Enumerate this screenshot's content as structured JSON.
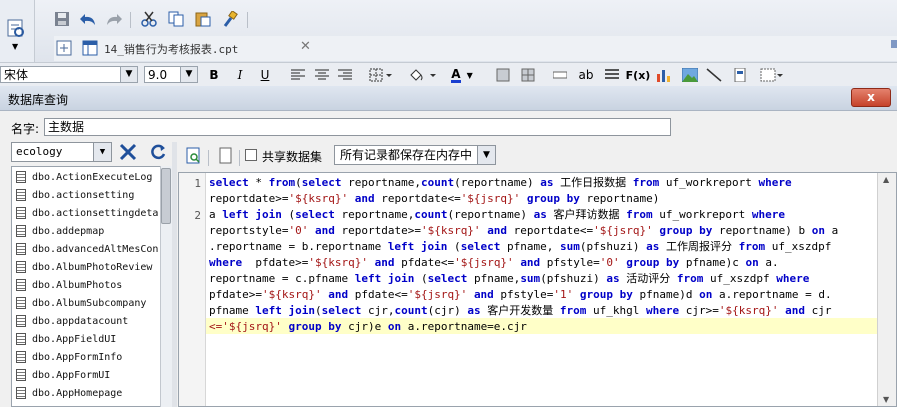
{
  "tab": {
    "file_name": "14_销售行为考核报表.cpt"
  },
  "format_bar": {
    "font_name": "宋体",
    "font_size": "9.0",
    "bold": "B",
    "italic": "I",
    "underline": "U",
    "text_ab": "ab",
    "formula": "F(x)",
    "font_color_letter": "A"
  },
  "dialog": {
    "title": "数据库查询",
    "close": "x",
    "name_label": "名字:",
    "name_value": "主数据",
    "db_selected": "ecology",
    "shared_label": "共享数据集",
    "save_mode": "所有记录都保存在内存中"
  },
  "tables": [
    "dbo.ActionExecuteLog",
    "dbo.actionsetting",
    "dbo.actionsettingdeta",
    "dbo.addepmap",
    "dbo.advancedAltMesCon",
    "dbo.AlbumPhotoReview",
    "dbo.AlbumPhotos",
    "dbo.AlbumSubcompany",
    "dbo.appdatacount",
    "dbo.AppFieldUI",
    "dbo.AppFormInfo",
    "dbo.AppFormUI",
    "dbo.AppHomepage"
  ],
  "editor": {
    "line_numbers": [
      "1",
      "2"
    ],
    "lines": [
      [
        {
          "t": "select",
          "k": 1
        },
        {
          "t": " * "
        },
        {
          "t": "from",
          "k": 1
        },
        {
          "t": "("
        },
        {
          "t": "select",
          "k": 1
        },
        {
          "t": " reportname,"
        },
        {
          "t": "count",
          "k": 1
        },
        {
          "t": "(reportname) "
        },
        {
          "t": "as",
          "k": 1
        },
        {
          "t": " 工作日报数据 "
        },
        {
          "t": "from",
          "k": 1
        },
        {
          "t": " uf_workreport "
        },
        {
          "t": "where",
          "k": 1
        }
      ],
      [
        {
          "t": "reportdate>="
        },
        {
          "t": "'${ksrq}'",
          "s": 1
        },
        {
          "t": " "
        },
        {
          "t": "and",
          "k": 1
        },
        {
          "t": " reportdate<="
        },
        {
          "t": "'${jsrq}'",
          "s": 1
        },
        {
          "t": " "
        },
        {
          "t": "group",
          "k": 1
        },
        {
          "t": " "
        },
        {
          "t": "by",
          "k": 1
        },
        {
          "t": " reportname)"
        }
      ],
      [
        {
          "t": "a "
        },
        {
          "t": "left",
          "k": 1
        },
        {
          "t": " "
        },
        {
          "t": "join",
          "k": 1
        },
        {
          "t": " ("
        },
        {
          "t": "select",
          "k": 1
        },
        {
          "t": " reportname,"
        },
        {
          "t": "count",
          "k": 1
        },
        {
          "t": "(reportname) "
        },
        {
          "t": "as",
          "k": 1
        },
        {
          "t": " 客户拜访数据 "
        },
        {
          "t": "from",
          "k": 1
        },
        {
          "t": " uf_workreport "
        },
        {
          "t": "where",
          "k": 1
        }
      ],
      [
        {
          "t": "reportstyle="
        },
        {
          "t": "'0'",
          "s": 1
        },
        {
          "t": " "
        },
        {
          "t": "and",
          "k": 1
        },
        {
          "t": " reportdate>="
        },
        {
          "t": "'${ksrq}'",
          "s": 1
        },
        {
          "t": " "
        },
        {
          "t": "and",
          "k": 1
        },
        {
          "t": " reportdate<="
        },
        {
          "t": "'${jsrq}'",
          "s": 1
        },
        {
          "t": " "
        },
        {
          "t": "group",
          "k": 1
        },
        {
          "t": " "
        },
        {
          "t": "by",
          "k": 1
        },
        {
          "t": " reportname) b "
        },
        {
          "t": "on",
          "k": 1
        },
        {
          "t": " a"
        }
      ],
      [
        {
          "t": ".reportname = b.reportname "
        },
        {
          "t": "left",
          "k": 1
        },
        {
          "t": " "
        },
        {
          "t": "join",
          "k": 1
        },
        {
          "t": " ("
        },
        {
          "t": "select",
          "k": 1
        },
        {
          "t": " pfname, "
        },
        {
          "t": "sum",
          "k": 1
        },
        {
          "t": "(pfshuzi) "
        },
        {
          "t": "as",
          "k": 1
        },
        {
          "t": " 工作周报评分 "
        },
        {
          "t": "from",
          "k": 1
        },
        {
          "t": " uf_xszdpf"
        }
      ],
      [
        {
          "t": "where",
          "k": 1
        },
        {
          "t": "  pfdate>="
        },
        {
          "t": "'${ksrq}'",
          "s": 1
        },
        {
          "t": " "
        },
        {
          "t": "and",
          "k": 1
        },
        {
          "t": " pfdate<="
        },
        {
          "t": "'${jsrq}'",
          "s": 1
        },
        {
          "t": " "
        },
        {
          "t": "and",
          "k": 1
        },
        {
          "t": " pfstyle="
        },
        {
          "t": "'0'",
          "s": 1
        },
        {
          "t": " "
        },
        {
          "t": "group",
          "k": 1
        },
        {
          "t": " "
        },
        {
          "t": "by",
          "k": 1
        },
        {
          "t": " pfname)c "
        },
        {
          "t": "on",
          "k": 1
        },
        {
          "t": " a."
        }
      ],
      [
        {
          "t": "reportname = c.pfname "
        },
        {
          "t": "left",
          "k": 1
        },
        {
          "t": " "
        },
        {
          "t": "join",
          "k": 1
        },
        {
          "t": " ("
        },
        {
          "t": "select",
          "k": 1
        },
        {
          "t": " pfname,"
        },
        {
          "t": "sum",
          "k": 1
        },
        {
          "t": "(pfshuzi) "
        },
        {
          "t": "as",
          "k": 1
        },
        {
          "t": " 活动评分 "
        },
        {
          "t": "from",
          "k": 1
        },
        {
          "t": " uf_xszdpf "
        },
        {
          "t": "where",
          "k": 1
        }
      ],
      [
        {
          "t": "pfdate>="
        },
        {
          "t": "'${ksrq}'",
          "s": 1
        },
        {
          "t": " "
        },
        {
          "t": "and",
          "k": 1
        },
        {
          "t": " pfdate<="
        },
        {
          "t": "'${jsrq}'",
          "s": 1
        },
        {
          "t": " "
        },
        {
          "t": "and",
          "k": 1
        },
        {
          "t": " pfstyle="
        },
        {
          "t": "'1'",
          "s": 1
        },
        {
          "t": " "
        },
        {
          "t": "group",
          "k": 1
        },
        {
          "t": " "
        },
        {
          "t": "by",
          "k": 1
        },
        {
          "t": " pfname)d "
        },
        {
          "t": "on",
          "k": 1
        },
        {
          "t": " a.reportname = d."
        }
      ],
      [
        {
          "t": "pfname "
        },
        {
          "t": "left",
          "k": 1
        },
        {
          "t": " "
        },
        {
          "t": "join",
          "k": 1
        },
        {
          "t": "("
        },
        {
          "t": "select",
          "k": 1
        },
        {
          "t": " cjr,"
        },
        {
          "t": "count",
          "k": 1
        },
        {
          "t": "(cjr) "
        },
        {
          "t": "as",
          "k": 1
        },
        {
          "t": " 客户开发数量 "
        },
        {
          "t": "from",
          "k": 1
        },
        {
          "t": " uf_khgl "
        },
        {
          "t": "where",
          "k": 1
        },
        {
          "t": " cjr>="
        },
        {
          "t": "'${ksrq}'",
          "s": 1
        },
        {
          "t": " "
        },
        {
          "t": "and",
          "k": 1
        },
        {
          "t": " cjr"
        }
      ],
      [
        {
          "t": "<=",
          "s": 1
        },
        {
          "t": "'${jsrq}'",
          "s": 1
        },
        {
          "t": " "
        },
        {
          "t": "group",
          "k": 1
        },
        {
          "t": " "
        },
        {
          "t": "by",
          "k": 1
        },
        {
          "t": " cjr)e "
        },
        {
          "t": "on",
          "k": 1
        },
        {
          "t": " a.reportname=e.cjr"
        }
      ]
    ]
  },
  "icons": {
    "save": "save-icon",
    "undo": "undo-icon",
    "redo": "redo-icon",
    "cut": "cut-icon",
    "copy": "copy-icon",
    "paste": "paste-icon",
    "format_brush": "format-brush-icon"
  },
  "colors": {
    "keyword": "#0000c8",
    "string": "#a31515",
    "highlight": "#ffffc8",
    "close_button": "#c6432b"
  }
}
